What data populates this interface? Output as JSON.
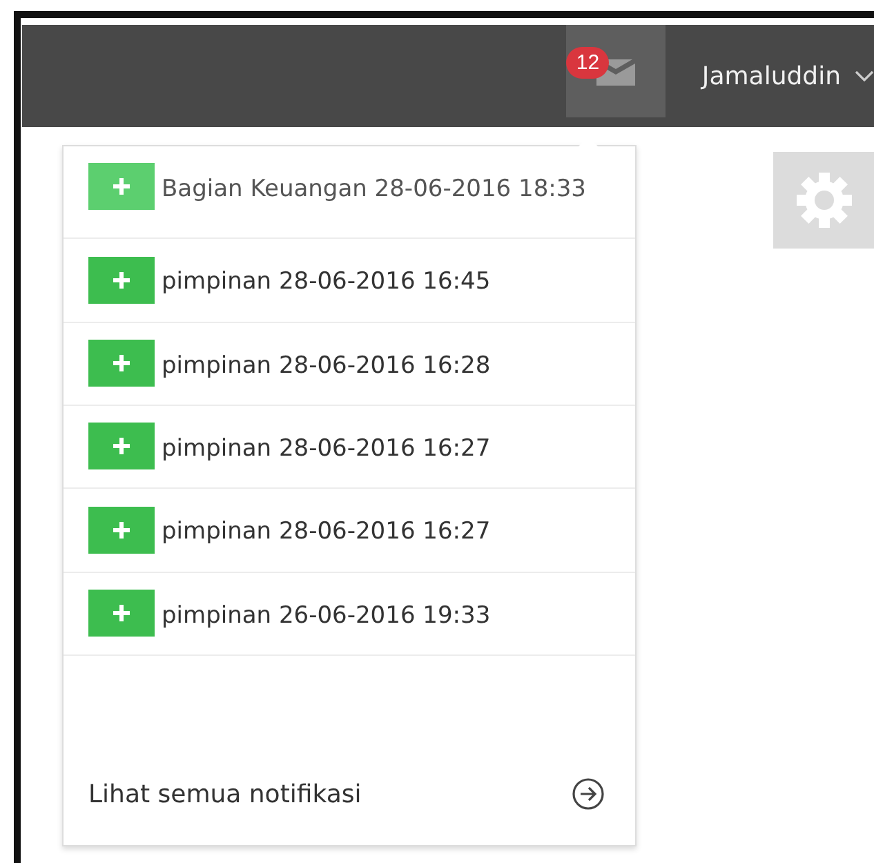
{
  "topbar": {
    "notification_count": "12",
    "user_name": "Jamaluddin"
  },
  "notifications": {
    "items": [
      {
        "text": "Bagian Keuangan 28-06-2016 18:33",
        "selected": true
      },
      {
        "text": "pimpinan 28-06-2016 16:45",
        "selected": false
      },
      {
        "text": "pimpinan 28-06-2016 16:28",
        "selected": false
      },
      {
        "text": "pimpinan 28-06-2016 16:27",
        "selected": false
      },
      {
        "text": "pimpinan 28-06-2016 16:27",
        "selected": false
      },
      {
        "text": "pimpinan 26-06-2016 19:33",
        "selected": false
      }
    ],
    "footer_link": "Lihat semua notifikasi"
  }
}
